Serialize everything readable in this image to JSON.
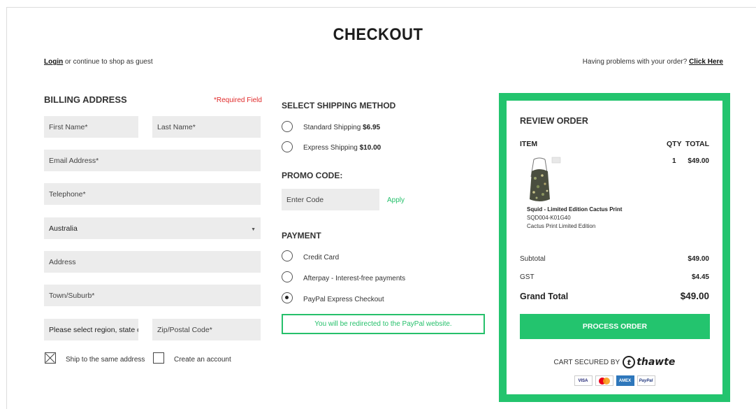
{
  "page": {
    "title": "CHECKOUT"
  },
  "topbar": {
    "login_link": "Login",
    "login_suffix": " or continue to shop as guest",
    "help_text": "Having problems with your order? ",
    "help_link": "Click Here"
  },
  "billing": {
    "heading": "BILLING ADDRESS",
    "required_note": "*Required Field",
    "first_name": "First Name*",
    "last_name": "Last Name*",
    "email": "Email Address*",
    "telephone": "Telephone*",
    "country": "Australia",
    "address": "Address",
    "town": "Town/Suburb*",
    "region": "Please select region, state o",
    "zip": "Zip/Postal Code*",
    "ship_same": "Ship to the same address",
    "create_account": "Create an account"
  },
  "shipping": {
    "heading": "SELECT SHIPPING METHOD",
    "options": [
      {
        "label": "Standard Shipping ",
        "price": "$6.95"
      },
      {
        "label": "Express Shipping ",
        "price": "$10.00"
      }
    ]
  },
  "promo": {
    "heading": "PROMO CODE:",
    "placeholder": "Enter Code",
    "apply": "Apply"
  },
  "payment": {
    "heading": "PAYMENT",
    "options": [
      {
        "label": "Credit Card"
      },
      {
        "label": "Afterpay - Interest-free payments"
      },
      {
        "label": "PayPal Express Checkout"
      }
    ],
    "notice": "You will be redirected to the PayPal website."
  },
  "review": {
    "heading": "REVIEW ORDER",
    "col_item": "ITEM",
    "col_qty": "QTY",
    "col_total": "TOTAL",
    "item": {
      "name": "Squid - Limited Edition Cactus Print",
      "sku": "SQD004-K01G40",
      "variant": "Cactus Print Limited Edition",
      "qty": "1",
      "total": "$49.00"
    },
    "subtotal_label": "Subtotal",
    "subtotal": "$49.00",
    "gst_label": "GST",
    "gst": "$4.45",
    "grand_label": "Grand Total",
    "grand_total": "$49.00",
    "process_button": "PROCESS ORDER",
    "secured_text": "CART SECURED BY",
    "secured_brand": "thawte",
    "cards": [
      "VISA",
      "MC",
      "AMEX",
      "PayPal"
    ]
  },
  "colors": {
    "accent": "#23c46e",
    "required": "#e02b2b",
    "field_bg": "#ececec"
  }
}
